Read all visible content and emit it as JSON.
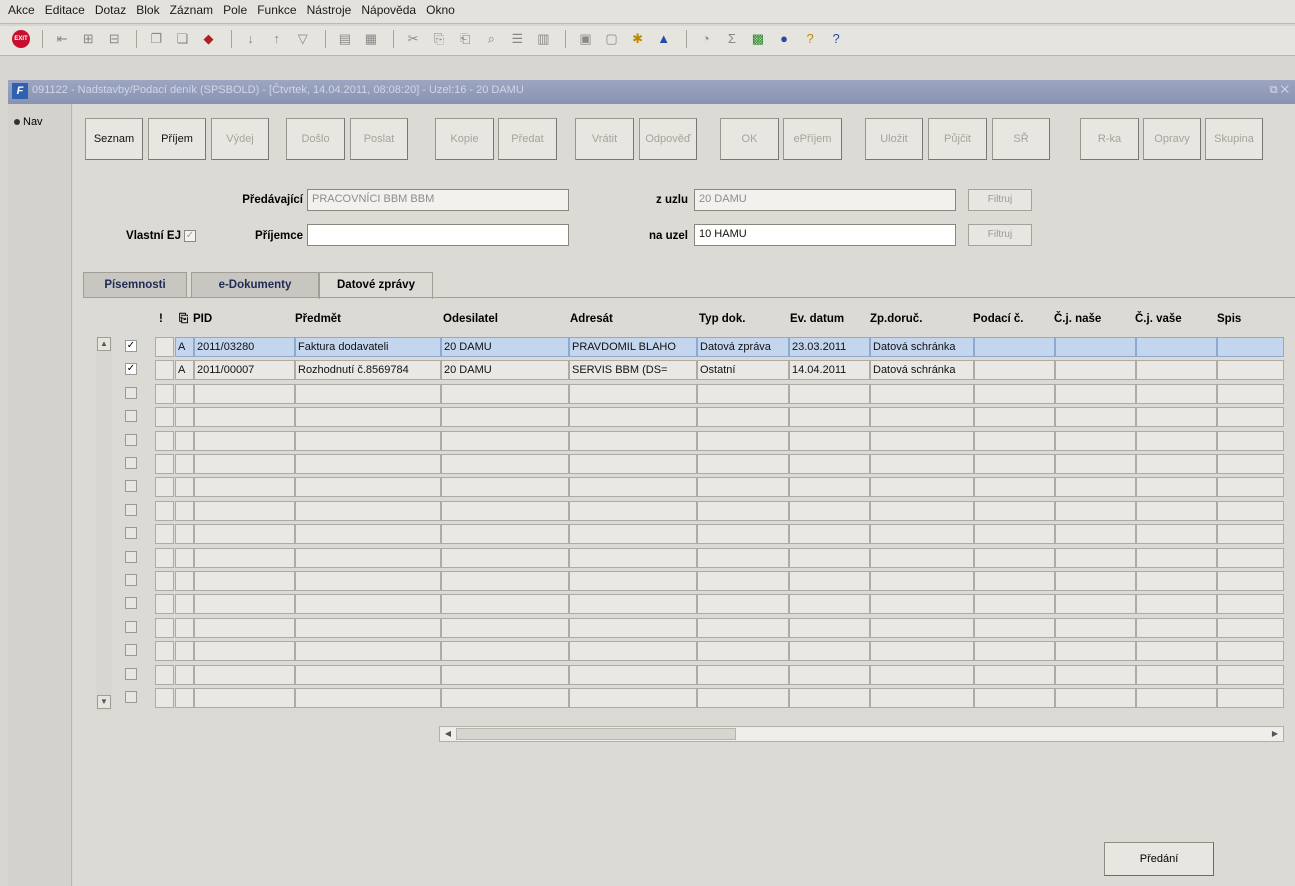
{
  "menu": [
    "Akce",
    "Editace",
    "Dotaz",
    "Blok",
    "Záznam",
    "Pole",
    "Funkce",
    "Nástroje",
    "Nápověda",
    "Okno"
  ],
  "window": {
    "title": "091122 - Nadstavby/Podací deník (SPSBOLD) - [Čtvrtek, 14.04.2011, 08:08:20] - Uzel:16 - 20 DAMU"
  },
  "nav": {
    "label": "Nav"
  },
  "buttons": {
    "seznam": "Seznam",
    "prijem": "Příjem",
    "vydej": "Výdej",
    "doslo": "Došlo",
    "poslat": "Poslat",
    "kopie": "Kopie",
    "predat": "Předat",
    "vratit": "Vrátit",
    "odpoved": "Odpověď",
    "ok": "OK",
    "eprijem": "ePříjem",
    "ulozit": "Uložit",
    "pujcit": "Půjčit",
    "sr": "SŘ",
    "rka": "R-ka",
    "opravy": "Opravy",
    "skupina": "Skupina"
  },
  "form": {
    "predavajici_label": "Předávající",
    "predavajici_value": "PRACOVNÍCI BBM BBM",
    "vlastni_ej_label": "Vlastní EJ",
    "prijemce_label": "Příjemce",
    "prijemce_value": "",
    "z_uzlu_label": "z uzlu",
    "z_uzlu_value": "20 DAMU",
    "na_uzel_label": "na uzel",
    "na_uzel_value": "10 HAMU",
    "filtruj1": "Filtruj",
    "filtruj2": "Filtruj"
  },
  "tabs": [
    "Písemnosti",
    "e-Dokumenty",
    "Datové zprávy"
  ],
  "columns": [
    "!",
    "PID",
    "Předmět",
    "Odesilatel",
    "Adresát",
    "Typ dok.",
    "Ev. datum",
    "Zp.doruč.",
    "Podací č.",
    "Č.j. naše",
    "Č.j. vaše",
    "Spis"
  ],
  "rows": [
    {
      "a": "A",
      "pid": "2011/03280",
      "predmet": "Faktura dodavateli",
      "odesilatel": "20 DAMU",
      "adresat": "PRAVDOMIL BLAHO",
      "typ": "Datová zpráva",
      "datum": "23.03.2011",
      "zpusob": "Datová schránka",
      "podaci": "",
      "cj_nase": "",
      "cj_vase": "",
      "spis": ""
    },
    {
      "a": "A",
      "pid": "2011/00007",
      "predmet": "Rozhodnutí č.8569784",
      "odesilatel": "20 DAMU",
      "adresat": "SERVIS BBM (DS=",
      "typ": "Ostatní",
      "datum": "14.04.2011",
      "zpusob": "Datová schránka",
      "podaci": "",
      "cj_nase": "",
      "cj_vase": "",
      "spis": ""
    }
  ],
  "predani": "Předání"
}
